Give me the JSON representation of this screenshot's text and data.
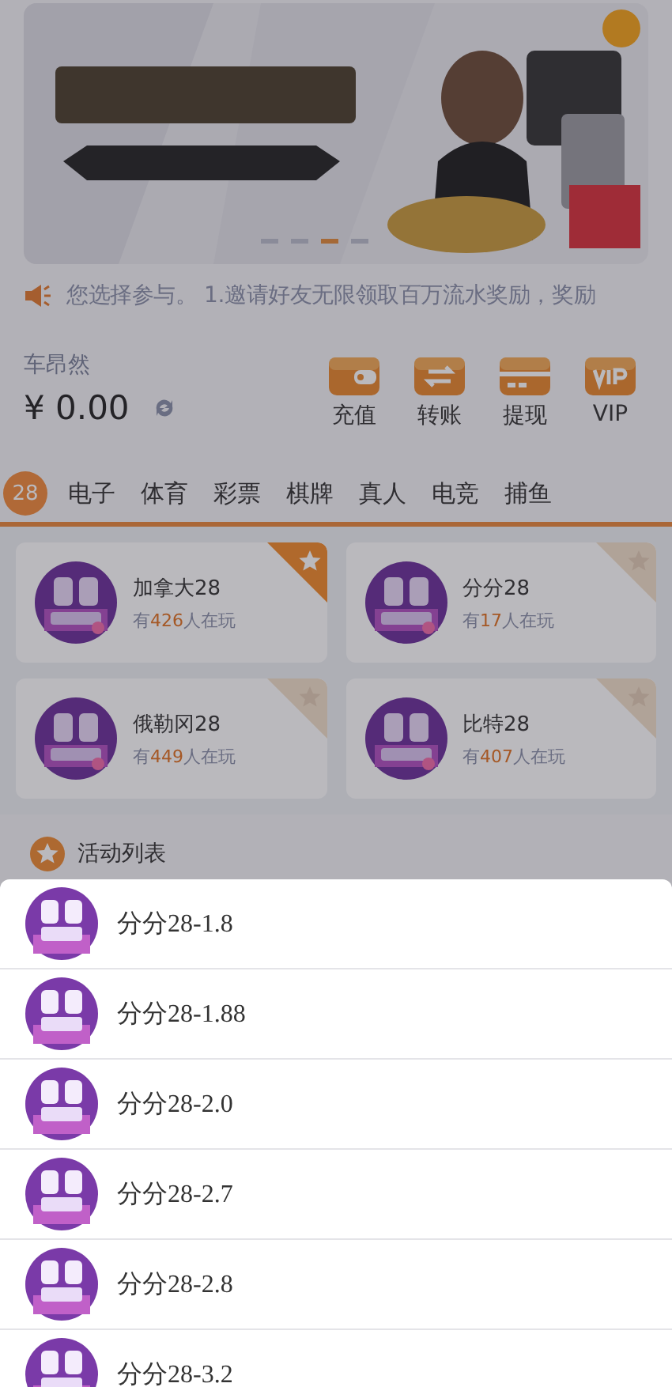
{
  "banner": {
    "slides": [
      {
        "selected": false
      },
      {
        "selected": false
      },
      {
        "selected": true
      },
      {
        "selected": false
      }
    ]
  },
  "notice": {
    "text": "您选择参与。 1.邀请好友无限领取百万流水奖励，奖励"
  },
  "account": {
    "name": "车昂然",
    "balance": "¥ 0.00"
  },
  "actions": [
    {
      "label": "充值",
      "kind": "wallet"
    },
    {
      "label": "转账",
      "kind": "transfer"
    },
    {
      "label": "提现",
      "kind": "card"
    },
    {
      "label": "VIP",
      "kind": "vip"
    }
  ],
  "tabs": [
    {
      "label": "28",
      "selected": true
    },
    {
      "label": "电子",
      "selected": false
    },
    {
      "label": "体育",
      "selected": false
    },
    {
      "label": "彩票",
      "selected": false
    },
    {
      "label": "棋牌",
      "selected": false
    },
    {
      "label": "真人",
      "selected": false
    },
    {
      "label": "电竞",
      "selected": false
    },
    {
      "label": "捕鱼",
      "selected": false
    }
  ],
  "games": [
    {
      "name": "加拿大28",
      "prefix": "有",
      "players": "426",
      "suffix": "人在玩",
      "favorite": true
    },
    {
      "name": "分分28",
      "prefix": "有",
      "players": "17",
      "suffix": "人在玩",
      "favorite": false
    },
    {
      "name": "俄勒冈28",
      "prefix": "有",
      "players": "449",
      "suffix": "人在玩",
      "favorite": false
    },
    {
      "name": "比特28",
      "prefix": "有",
      "players": "407",
      "suffix": "人在玩",
      "favorite": false
    }
  ],
  "activity": {
    "title": "活动列表"
  },
  "sheet": {
    "items": [
      "分分28-1.8",
      "分分28-1.88",
      "分分28-2.0",
      "分分28-2.7",
      "分分28-2.8",
      "分分28-3.2"
    ]
  }
}
